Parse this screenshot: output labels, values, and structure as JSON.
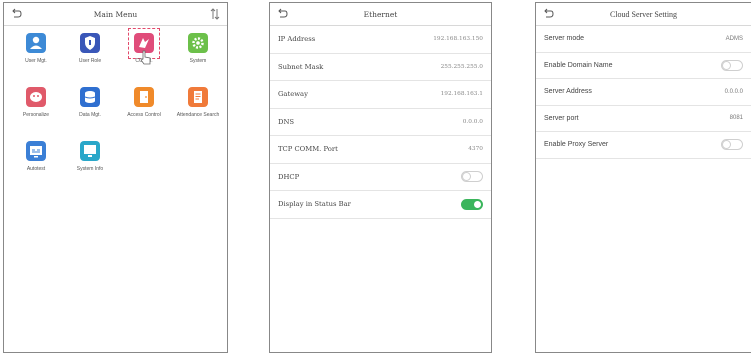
{
  "colors": {
    "user_mgt": "#3d8ad6",
    "user_role": "#3a57b8",
    "comm": "#e04c7a",
    "system": "#6cc04a",
    "personalize": "#e05a6a",
    "data_mgt": "#2f6fd0",
    "access_control": "#f08a2a",
    "attendance_search": "#f07a3a",
    "autotest": "#3b7fd6",
    "system_info": "#2aa7c9",
    "toggle_on": "#3bb55c"
  },
  "main_menu": {
    "title": "Main Menu",
    "tiles": [
      {
        "label": "User Mgt.",
        "icon": "user-icon"
      },
      {
        "label": "User Role",
        "icon": "shield-icon"
      },
      {
        "label": "COMM.",
        "icon": "comm-icon"
      },
      {
        "label": "System",
        "icon": "gear-icon"
      },
      {
        "label": "Personalize",
        "icon": "palette-icon"
      },
      {
        "label": "Data Mgt.",
        "icon": "database-icon"
      },
      {
        "label": "Access Control",
        "icon": "door-icon"
      },
      {
        "label": "Attendance Search",
        "icon": "document-icon"
      },
      {
        "label": "Autotest",
        "icon": "monitor-test-icon"
      },
      {
        "label": "System Info",
        "icon": "monitor-icon"
      }
    ]
  },
  "ethernet": {
    "title": "Ethernet",
    "rows": [
      {
        "label": "IP Address",
        "value": "192.168.163.150"
      },
      {
        "label": "Subnet Mask",
        "value": "255.255.255.0"
      },
      {
        "label": "Gateway",
        "value": "192.168.163.1"
      },
      {
        "label": "DNS",
        "value": "0.0.0.0"
      },
      {
        "label": "TCP COMM. Port",
        "value": "4370"
      },
      {
        "label": "DHCP",
        "toggle": false
      },
      {
        "label": "Display in Status Bar",
        "toggle": true
      }
    ]
  },
  "cloud": {
    "title": "Cloud Server Setting",
    "rows": [
      {
        "label": "Server mode",
        "value": "ADMS"
      },
      {
        "label": "Enable Domain Name",
        "toggle": false
      },
      {
        "label": "Server Address",
        "value": "0.0.0.0"
      },
      {
        "label": "Server port",
        "value": "8081"
      },
      {
        "label": "Enable Proxy Server",
        "toggle": false
      }
    ]
  }
}
